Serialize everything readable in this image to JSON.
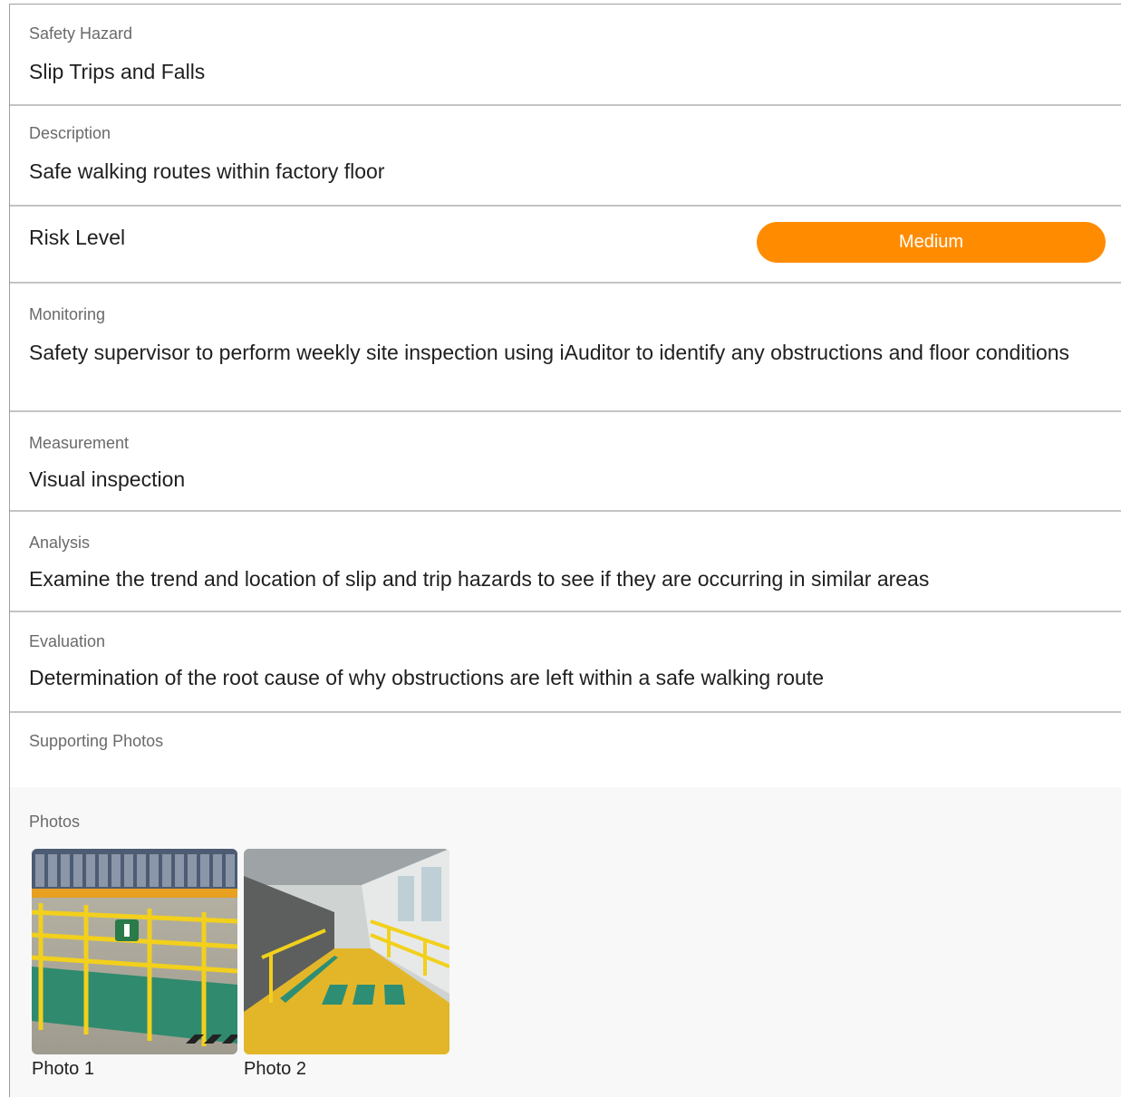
{
  "fields": {
    "hazard": {
      "label": "Safety Hazard",
      "value": "Slip Trips and Falls"
    },
    "description": {
      "label": "Description",
      "value": "Safe walking routes within factory floor"
    },
    "risk": {
      "label": "Risk Level",
      "value": "Medium",
      "color": "#ff8c00"
    },
    "monitoring": {
      "label": "Monitoring",
      "value": "Safety supervisor to perform weekly site inspection using iAuditor to identify any obstructions and floor conditions"
    },
    "measurement": {
      "label": "Measurement",
      "value": "Visual inspection"
    },
    "analysis": {
      "label": "Analysis",
      "value": "Examine the trend and location of slip and trip hazards to see if they are occurring in similar areas"
    },
    "evaluation": {
      "label": "Evaluation",
      "value": "Determination of the root cause of why obstructions are left within a safe walking route"
    },
    "supporting_photos": {
      "label": "Supporting Photos"
    }
  },
  "photos": {
    "label": "Photos",
    "items": [
      {
        "caption": "Photo 1",
        "icon": "warehouse-railing-image"
      },
      {
        "caption": "Photo 2",
        "icon": "factory-walkway-image"
      }
    ]
  }
}
